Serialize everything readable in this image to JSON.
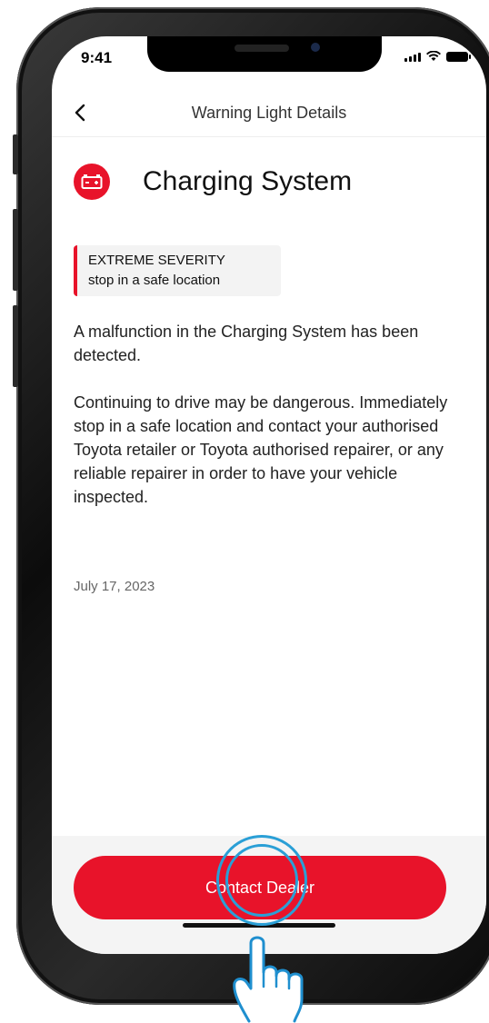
{
  "status_bar": {
    "time": "9:41"
  },
  "header": {
    "title": "Warning Light Details",
    "back_icon": "chevron-left-icon"
  },
  "warning": {
    "icon": "battery-icon",
    "title": "Charging System",
    "severity_level": "EXTREME SEVERITY",
    "severity_advice": "stop in a safe location",
    "description": [
      "A malfunction in the Charging System has been detected.",
      "Continuing to drive may be dangerous. Immediately stop in a safe location and contact your authorised Toyota retailer or Toyota authorised repairer, or any reliable repairer in order to have your vehicle inspected."
    ],
    "date": "July 17, 2023"
  },
  "footer": {
    "cta_label": "Contact Dealer"
  },
  "colors": {
    "accent": "#e8132a",
    "tap_indicator": "#2a9fd6"
  }
}
